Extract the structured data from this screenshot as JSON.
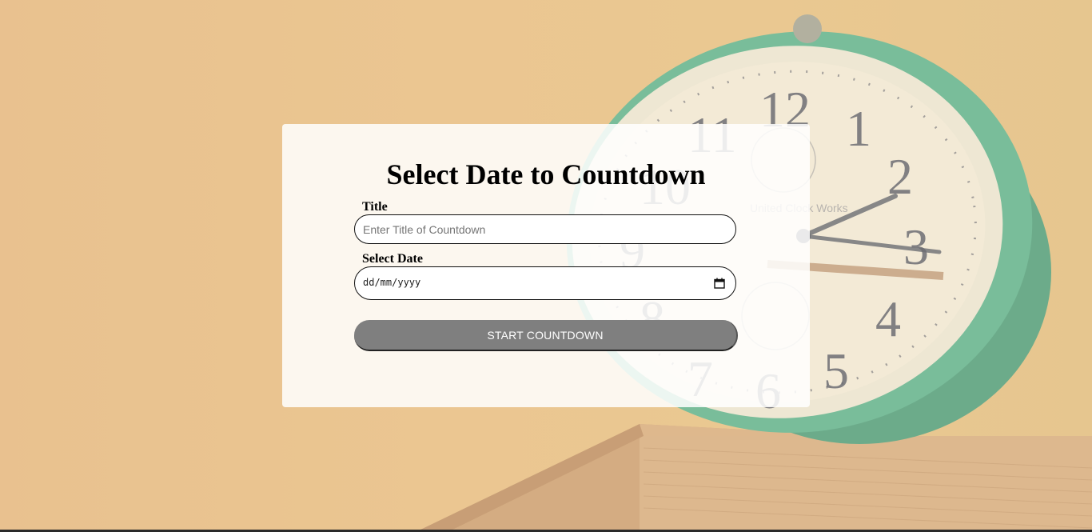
{
  "form": {
    "heading": "Select Date to Countdown",
    "title_label": "Title",
    "title_placeholder": "Enter Title of Countdown",
    "title_value": "",
    "date_label": "Select Date",
    "date_placeholder": "dd/mm/yyyy",
    "submit_label": "START COUNTDOWN",
    "calendar_icon": "calendar-icon"
  },
  "background": {
    "clock_numerals": [
      "12",
      "1",
      "2",
      "3",
      "4",
      "5",
      "6",
      "7",
      "8",
      "9",
      "10",
      "11"
    ],
    "clock_brand": "United Clock Works",
    "colors": {
      "wall": "#e8c48f",
      "clock_rim": "#3aa58e",
      "book": "#c79a76",
      "card": "#ffffff",
      "button": "#7f7f7f"
    }
  }
}
